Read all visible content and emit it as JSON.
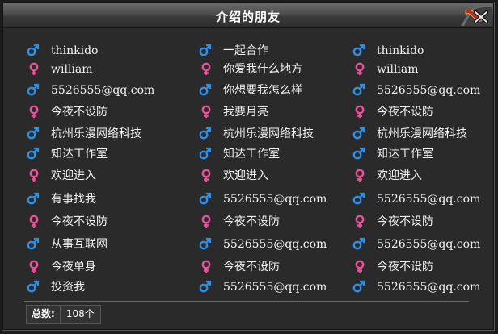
{
  "window": {
    "title": "介绍的朋友"
  },
  "icons": {
    "male_color": "#2c8fe8",
    "female_color": "#ea4f9a",
    "close_icon": "close-icon"
  },
  "columns": [
    [
      {
        "sex": "male",
        "name": "thinkido"
      },
      {
        "sex": "female",
        "name": "william"
      },
      {
        "sex": "male",
        "name": "5526555@qq.com"
      },
      {
        "sex": "female",
        "name": "今夜不设防"
      },
      {
        "sex": "male",
        "name": "杭州乐漫网络科技"
      },
      {
        "sex": "male",
        "name": "知达工作室"
      },
      {
        "sex": "female",
        "name": "欢迎进入"
      },
      {
        "sex": "male",
        "name": "有事找我"
      },
      {
        "sex": "female",
        "name": "今夜不设防"
      },
      {
        "sex": "male",
        "name": "从事互联网"
      },
      {
        "sex": "female",
        "name": "今夜单身"
      },
      {
        "sex": "male",
        "name": "投资我"
      }
    ],
    [
      {
        "sex": "male",
        "name": "一起合作"
      },
      {
        "sex": "female",
        "name": "你爱我什么地方"
      },
      {
        "sex": "male",
        "name": "你想要我怎么样"
      },
      {
        "sex": "female",
        "name": "我要月亮"
      },
      {
        "sex": "male",
        "name": "杭州乐漫网络科技"
      },
      {
        "sex": "male",
        "name": "知达工作室"
      },
      {
        "sex": "female",
        "name": "欢迎进入"
      },
      {
        "sex": "male",
        "name": "5526555@qq.com"
      },
      {
        "sex": "female",
        "name": "今夜不设防"
      },
      {
        "sex": "male",
        "name": "5526555@qq.com"
      },
      {
        "sex": "female",
        "name": "今夜不设防"
      },
      {
        "sex": "male",
        "name": "5526555@qq.com"
      }
    ],
    [
      {
        "sex": "male",
        "name": "thinkido"
      },
      {
        "sex": "female",
        "name": "william"
      },
      {
        "sex": "male",
        "name": "5526555@qq.com"
      },
      {
        "sex": "female",
        "name": "今夜不设防"
      },
      {
        "sex": "male",
        "name": "杭州乐漫网络科技"
      },
      {
        "sex": "male",
        "name": "知达工作室"
      },
      {
        "sex": "female",
        "name": "欢迎进入"
      },
      {
        "sex": "male",
        "name": "5526555@qq.com"
      },
      {
        "sex": "female",
        "name": "今夜不设防"
      },
      {
        "sex": "male",
        "name": "5526555@qq.com"
      },
      {
        "sex": "female",
        "name": "今夜不设防"
      },
      {
        "sex": "male",
        "name": "5526555@qq.com"
      }
    ]
  ],
  "footer": {
    "total_label": "总数:",
    "total_value": "108个"
  }
}
